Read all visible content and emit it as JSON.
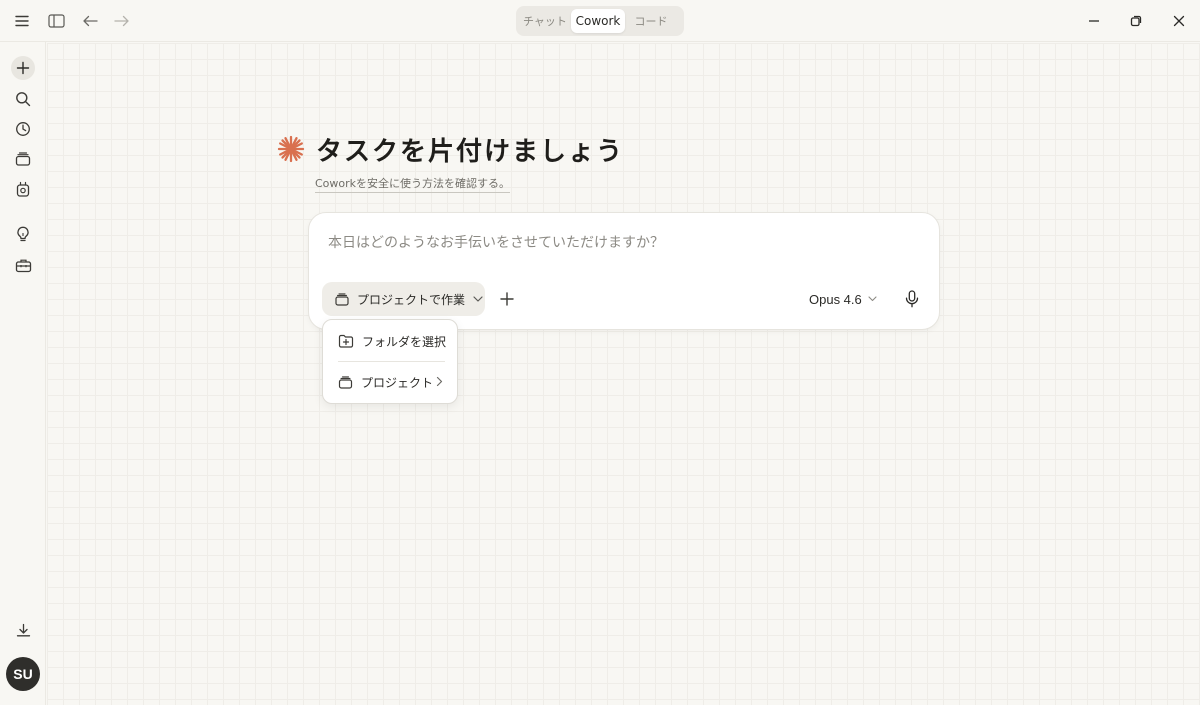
{
  "topbar": {
    "tabs": [
      {
        "label": "チャット"
      },
      {
        "label": "Cowork"
      },
      {
        "label": "コード"
      }
    ],
    "icons": [
      "menu-icon",
      "sidebar-toggle-icon",
      "back-arrow-icon",
      "forward-arrow-icon"
    ],
    "window_controls": [
      "minimize-icon",
      "restore-icon",
      "close-icon"
    ]
  },
  "sidebar": {
    "icons": [
      "new-chat-plus-icon",
      "search-icon",
      "history-clock-icon",
      "projects-stack-icon",
      "robot-icon",
      "lightbulb-icon",
      "toolbox-icon",
      "download-icon"
    ],
    "avatar_initials": "SU"
  },
  "main": {
    "title": "タスクを片付けましょう",
    "subtitle_link": "Coworkを安全に使う方法を確認する。",
    "accent_color": "#d9704f"
  },
  "composer": {
    "placeholder": "本日はどのようなお手伝いをさせていただけますか？",
    "project_button": "プロジェクトで作業",
    "model": "Opus 4.6"
  },
  "dropdown": {
    "items": [
      {
        "label": "フォルダを選択",
        "icon": "folder-plus-icon"
      },
      {
        "label": "プロジェクト",
        "icon": "project-stack-icon"
      }
    ]
  }
}
